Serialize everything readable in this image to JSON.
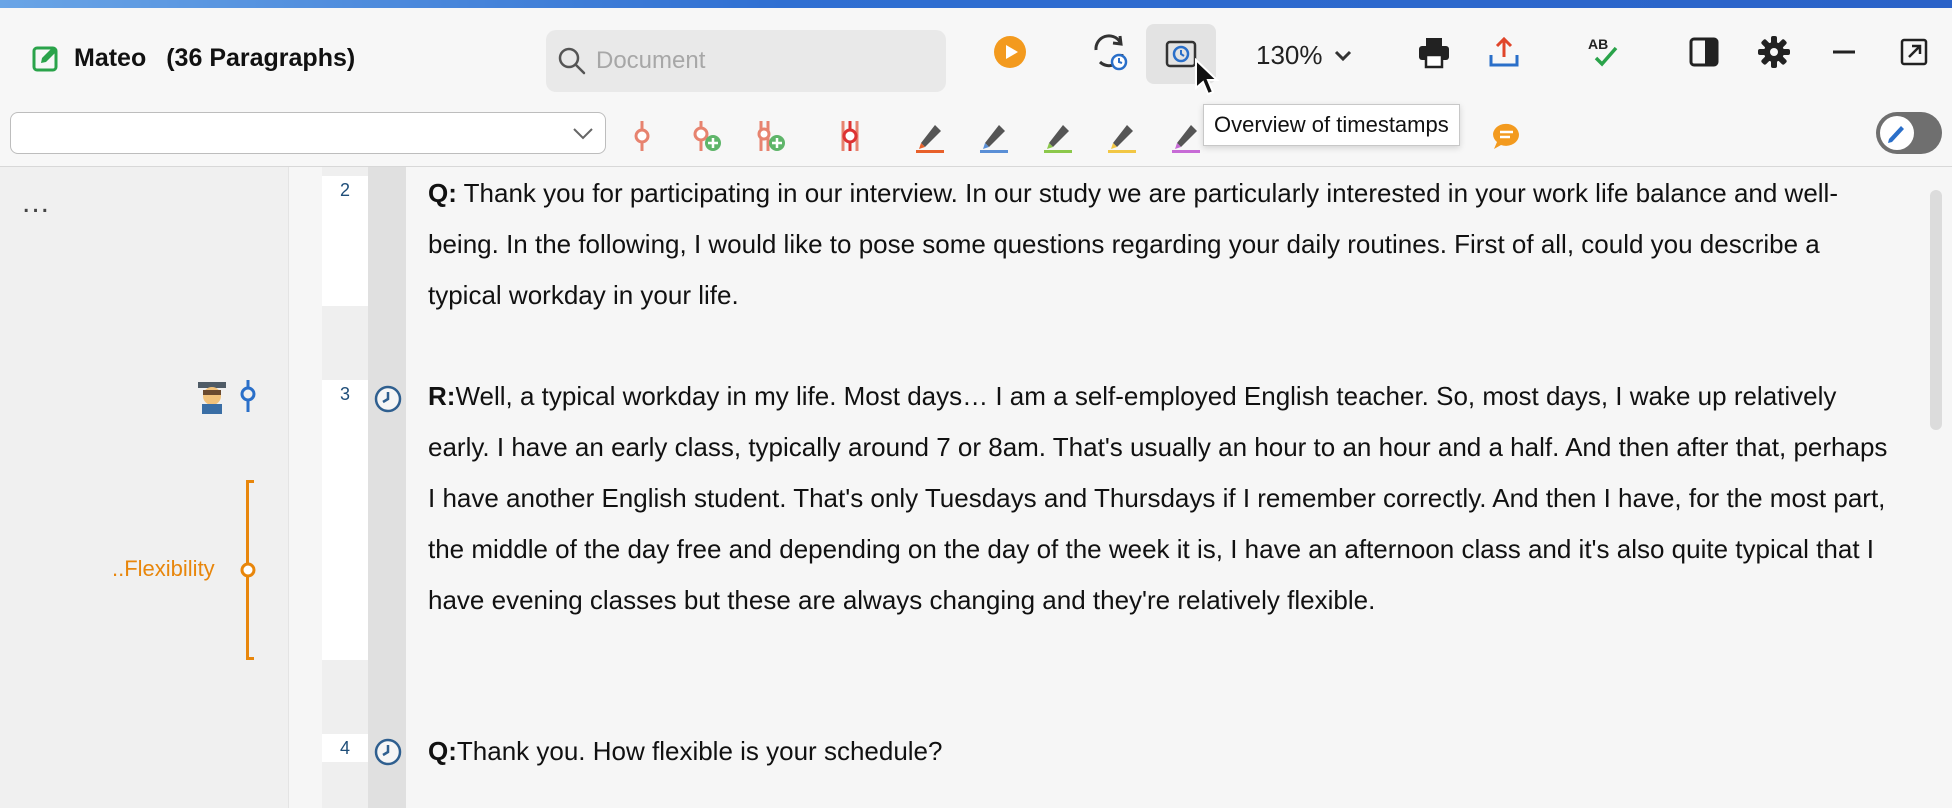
{
  "document": {
    "name": "Mateo",
    "paragraph_count": "(36 Paragraphs)"
  },
  "search": {
    "placeholder": "Document"
  },
  "toolbar": {
    "zoom": "130%"
  },
  "tooltip": {
    "text": "Overview of timestamps"
  },
  "colors": {
    "accent_orange": "#e8860b",
    "code_blue": "#2a6fc9",
    "toolbar_bg": "#f7f7f7"
  },
  "left_panel": {
    "more_label": "...",
    "code_label": "..Flexibility"
  },
  "paragraphs": [
    {
      "number": "2",
      "speaker": "Q:",
      "text": " Thank you for participating in our interview. In our study we are particularly interested in your work life balance and well-being. In the following, I would like to pose some questions regarding your daily routines. First of all, could you describe a typical workday in your life."
    },
    {
      "number": "3",
      "speaker": "R:",
      "text": "Well, a typical workday in my life. Most days… I am a self-employed English teacher. So, most days, I wake up relatively early. I have an early class, typically around 7 or 8am. That's usually an hour to an hour and a half. And then after that, perhaps I have another English student. That's only Tuesdays and Thursdays if I remember correctly. And then I have, for the most part, the middle of the day free and depending on the day of the week it is, I have an afternoon class and it's also quite typical that I have evening classes but these are always changing and they're relatively flexible."
    },
    {
      "number": "4",
      "speaker": "Q:",
      "text": "Thank you. How flexible is your schedule?"
    }
  ]
}
